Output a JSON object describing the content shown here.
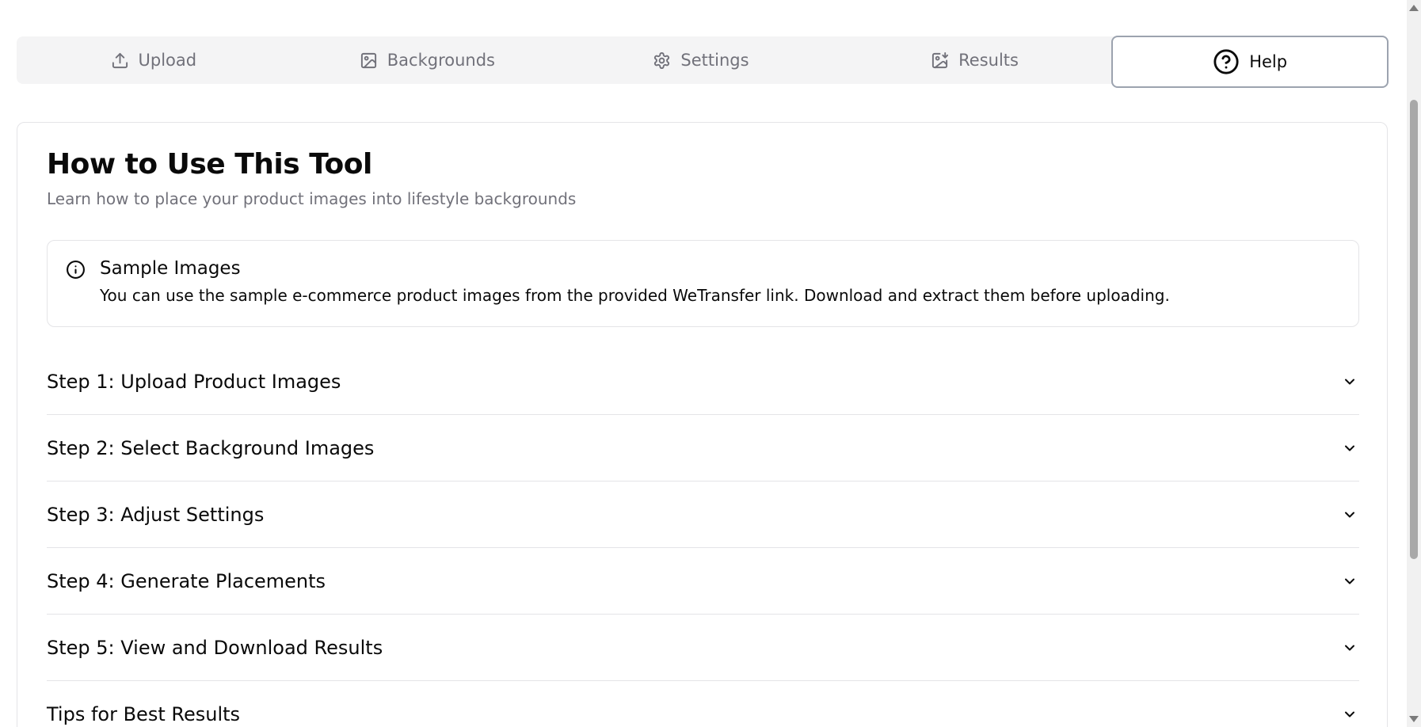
{
  "tabs": [
    {
      "label": "Upload",
      "icon": "upload-icon",
      "active": false
    },
    {
      "label": "Backgrounds",
      "icon": "image-icon",
      "active": false
    },
    {
      "label": "Settings",
      "icon": "gear-icon",
      "active": false
    },
    {
      "label": "Results",
      "icon": "image-download-icon",
      "active": false
    },
    {
      "label": "Help",
      "icon": "help-circle-icon",
      "active": true
    }
  ],
  "card": {
    "title": "How to Use This Tool",
    "description": "Learn how to place your product images into lifestyle backgrounds"
  },
  "alert": {
    "icon": "info-icon",
    "title": "Sample Images",
    "text": "You can use the sample e-commerce product images from the provided WeTransfer link. Download and extract them before uploading."
  },
  "accordion": [
    {
      "label": "Step 1: Upload Product Images"
    },
    {
      "label": "Step 2: Select Background Images"
    },
    {
      "label": "Step 3: Adjust Settings"
    },
    {
      "label": "Step 4: Generate Placements"
    },
    {
      "label": "Step 5: View and Download Results"
    },
    {
      "label": "Tips for Best Results"
    }
  ],
  "colors": {
    "tab_bg": "#f4f4f5",
    "muted_text": "#71717a",
    "border": "#e4e4e7",
    "active_border": "#9ca3af"
  }
}
